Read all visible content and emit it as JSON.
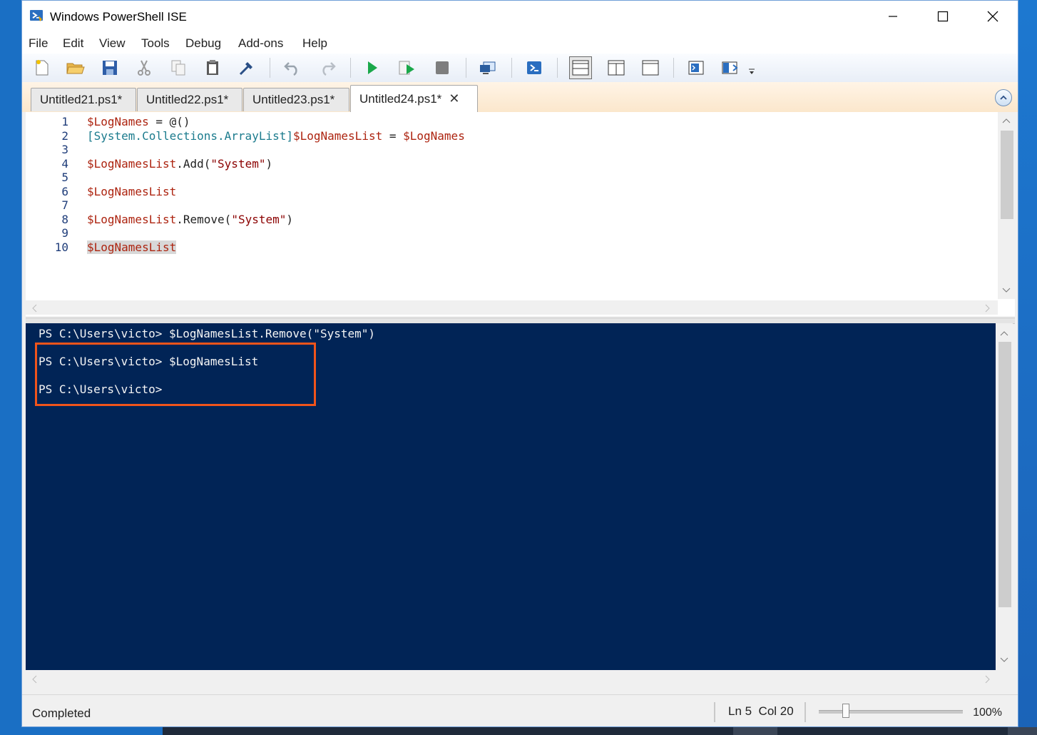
{
  "window": {
    "title": "Windows PowerShell ISE"
  },
  "menu": [
    "File",
    "Edit",
    "View",
    "Tools",
    "Debug",
    "Add-ons",
    "Help"
  ],
  "toolbar_icons": [
    "new-script-icon",
    "open-icon",
    "save-icon",
    "cut-icon",
    "copy-icon",
    "paste-icon",
    "clear-console-icon",
    "undo-icon",
    "redo-icon",
    "run-script-icon",
    "run-selection-icon",
    "stop-icon",
    "new-remote-tab-icon",
    "start-powershell-icon",
    "show-script-pane-top-icon",
    "show-script-pane-right-icon",
    "show-script-pane-maximized-icon",
    "show-script-pane-icon",
    "show-commands-addon-icon"
  ],
  "tabs": [
    {
      "label": "Untitled21.ps1*",
      "active": false
    },
    {
      "label": "Untitled22.ps1*",
      "active": false
    },
    {
      "label": "Untitled23.ps1*",
      "active": false
    },
    {
      "label": "Untitled24.ps1*",
      "active": true
    }
  ],
  "editor": {
    "line_numbers": [
      "1",
      "2",
      "3",
      "4",
      "5",
      "6",
      "7",
      "8",
      "9",
      "10"
    ],
    "lines": [
      [
        {
          "c": "v",
          "t": "$LogNames"
        },
        {
          "c": "p",
          "t": " = @()"
        }
      ],
      [
        {
          "c": "t",
          "t": "[System.Collections.ArrayList]"
        },
        {
          "c": "v",
          "t": "$LogNamesList"
        },
        {
          "c": "p",
          "t": " = "
        },
        {
          "c": "v",
          "t": "$LogNames"
        }
      ],
      [],
      [
        {
          "c": "v",
          "t": "$LogNamesList"
        },
        {
          "c": "p",
          "t": "."
        },
        {
          "c": "m",
          "t": "Add("
        },
        {
          "c": "s",
          "t": "\"System\""
        },
        {
          "c": "p",
          "t": ")"
        }
      ],
      [],
      [
        {
          "c": "v",
          "t": "$LogNamesList"
        }
      ],
      [],
      [
        {
          "c": "v",
          "t": "$LogNamesList"
        },
        {
          "c": "p",
          "t": "."
        },
        {
          "c": "m",
          "t": "Remove("
        },
        {
          "c": "s",
          "t": "\"System\""
        },
        {
          "c": "p",
          "t": ")"
        }
      ],
      [],
      [
        {
          "c": "v hl",
          "t": "$LogNamesList"
        }
      ]
    ]
  },
  "console": {
    "lines": [
      "PS C:\\Users\\victo> $LogNamesList.Remove(\"System\")",
      "PS C:\\Users\\victo> $LogNamesList",
      "PS C:\\Users\\victo>"
    ]
  },
  "status": {
    "text": "Completed",
    "ln": "Ln 5",
    "col": "Col 20",
    "zoom": "100%"
  },
  "colors": {
    "console_bg": "#012456",
    "highlight_box": "#f0541b",
    "variable": "#ad2410",
    "type": "#1b7b8d"
  }
}
